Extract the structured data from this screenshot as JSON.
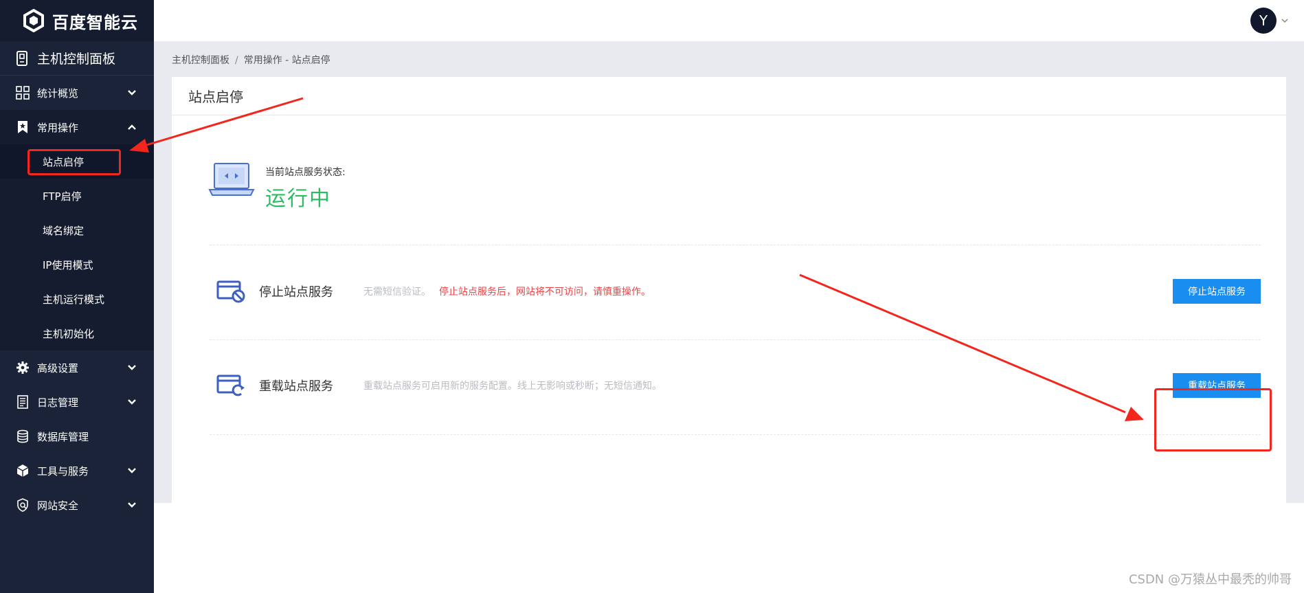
{
  "brand": {
    "name": "百度智能云"
  },
  "sidebar": {
    "panel_title": "主机控制面板",
    "items": [
      {
        "label": "统计概览",
        "icon": "grid-icon",
        "expandable": true
      },
      {
        "label": "常用操作",
        "icon": "bookmark-icon",
        "expandable": true,
        "expanded": true
      },
      {
        "label": "高级设置",
        "icon": "gear-icon",
        "expandable": true
      },
      {
        "label": "日志管理",
        "icon": "document-list-icon",
        "expandable": true
      },
      {
        "label": "数据库管理",
        "icon": "database-icon",
        "expandable": false
      },
      {
        "label": "工具与服务",
        "icon": "cube-icon",
        "expandable": true
      },
      {
        "label": "网站安全",
        "icon": "shield-search-icon",
        "expandable": true
      }
    ],
    "sub_items": [
      {
        "label": "站点启停",
        "active": true
      },
      {
        "label": "FTP启停"
      },
      {
        "label": "域名绑定"
      },
      {
        "label": "IP使用模式"
      },
      {
        "label": "主机运行模式"
      },
      {
        "label": "主机初始化"
      }
    ]
  },
  "header": {
    "avatar_letter": "Y"
  },
  "breadcrumb": {
    "root": "主机控制面板",
    "separator": "/",
    "current": "常用操作 - 站点启停"
  },
  "card": {
    "title": "站点启停",
    "status_label": "当前站点服务状态:",
    "status_value": "运行中",
    "actions": [
      {
        "title": "停止站点服务",
        "desc": "无需短信验证。",
        "warning": "停止站点服务后，网站将不可访问，请慎重操作。",
        "button": "停止站点服务"
      },
      {
        "title": "重载站点服务",
        "desc": "重载站点服务可启用新的服务配置。线上无影响或秒断；无短信通知。",
        "warning": "",
        "button": "重载站点服务"
      }
    ]
  },
  "colors": {
    "sidebar_bg": "#1b2338",
    "status_green": "#2bbd62",
    "button_blue": "#1a8ef0",
    "warning_red": "#e64545",
    "annotation_red": "#f2261c"
  },
  "watermark": "CSDN @万猿丛中最秃的帅哥"
}
